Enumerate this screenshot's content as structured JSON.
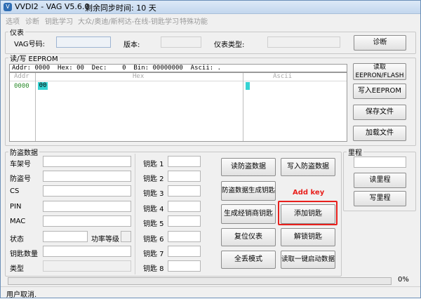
{
  "window": {
    "title": "VVDI2 - VAG V5.6.0",
    "sync_text": "剩余同步时间: 10 天"
  },
  "menu": [
    "选项",
    "诊断",
    "钥匙学习",
    "大众/奥迪/斯柯达-在线-钥匙学习",
    "特殊功能"
  ],
  "dashboard": {
    "legend": "仪表",
    "vag_label": "VAG号码:",
    "version_label": "版本:",
    "type_label": "仪表类型:",
    "diagnose_button": "诊断"
  },
  "eeprom": {
    "legend": "读/写 EEPROM",
    "addr_bar": "Addr: 0000  Hex: 00  Dec:    0  Bin: 00000000  Ascii: .",
    "col_addr": "Addr",
    "col_hex": "Hex",
    "col_ascii": "Ascii",
    "row_addr": "0000",
    "row_hex": "00",
    "buttons": {
      "read": "读取 EEPRON/FLASH",
      "write": "写入EEPROM",
      "save": "保存文件",
      "load": "加载文件"
    }
  },
  "immo": {
    "legend": "防盗数据",
    "labels": {
      "vin": "车架号",
      "immo_no": "防盗号",
      "cs": "CS",
      "pin": "PIN",
      "mac": "MAC",
      "status": "状态",
      "power_class": "功率等级",
      "key_count": "钥匙数量",
      "type": "类型"
    },
    "keys": [
      "钥匙 1",
      "钥匙 2",
      "钥匙 3",
      "钥匙 4",
      "钥匙 5",
      "钥匙 6",
      "钥匙 7",
      "钥匙 8"
    ]
  },
  "actions": {
    "read_immo": "读防盗数据",
    "write_immo": "写入防盗数据",
    "gen_key": "防盗数据生成钥匙",
    "gen_dealer_key": "生成经销商钥匙",
    "add_key": "添加钥匙",
    "reset_dash": "复位仪表",
    "unlock_key": "解锁钥匙",
    "full_mode": "全丢模式",
    "read_onekey": "读取一键启动数据",
    "annotation": "Add key"
  },
  "mileage": {
    "legend": "里程",
    "read": "读里程",
    "write": "写里程"
  },
  "progress": {
    "value": 0,
    "label": "0%"
  },
  "status": "用户取消."
}
